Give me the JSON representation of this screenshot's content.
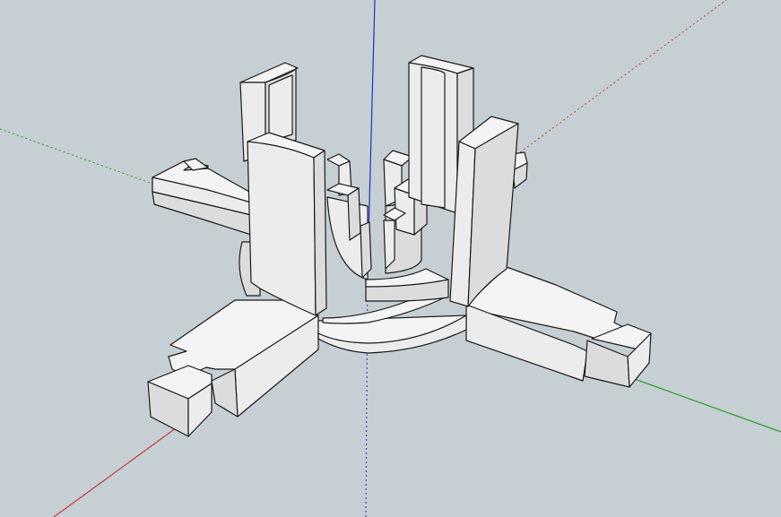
{
  "viewport": {
    "background_color": "#c6cfd3",
    "model_face_color": "#eeeeee",
    "edge_color": "#1a1a1a"
  },
  "axes": {
    "red_axis_color": "#c43c3c",
    "green_axis_color": "#2e9a2e",
    "blue_axis_color": "#2a2acc"
  }
}
